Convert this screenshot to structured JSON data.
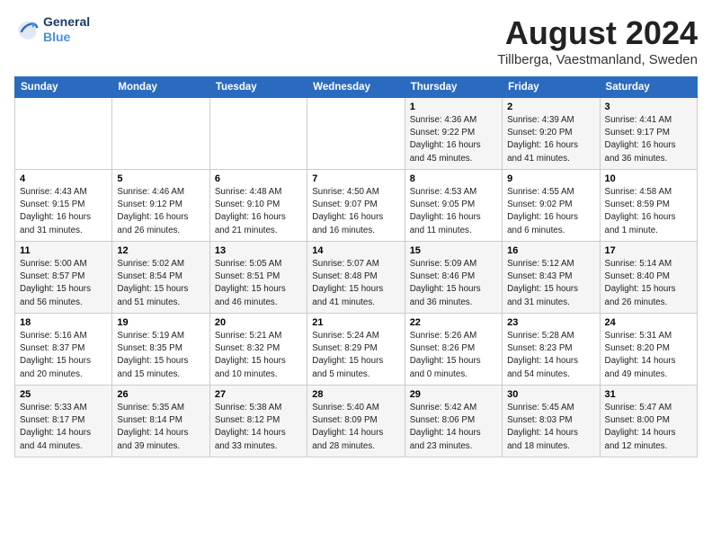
{
  "header": {
    "logo_line1": "General",
    "logo_line2": "Blue",
    "month": "August 2024",
    "location": "Tillberga, Vaestmanland, Sweden"
  },
  "weekdays": [
    "Sunday",
    "Monday",
    "Tuesday",
    "Wednesday",
    "Thursday",
    "Friday",
    "Saturday"
  ],
  "weeks": [
    [
      {
        "day": "",
        "info": ""
      },
      {
        "day": "",
        "info": ""
      },
      {
        "day": "",
        "info": ""
      },
      {
        "day": "",
        "info": ""
      },
      {
        "day": "1",
        "info": "Sunrise: 4:36 AM\nSunset: 9:22 PM\nDaylight: 16 hours\nand 45 minutes."
      },
      {
        "day": "2",
        "info": "Sunrise: 4:39 AM\nSunset: 9:20 PM\nDaylight: 16 hours\nand 41 minutes."
      },
      {
        "day": "3",
        "info": "Sunrise: 4:41 AM\nSunset: 9:17 PM\nDaylight: 16 hours\nand 36 minutes."
      }
    ],
    [
      {
        "day": "4",
        "info": "Sunrise: 4:43 AM\nSunset: 9:15 PM\nDaylight: 16 hours\nand 31 minutes."
      },
      {
        "day": "5",
        "info": "Sunrise: 4:46 AM\nSunset: 9:12 PM\nDaylight: 16 hours\nand 26 minutes."
      },
      {
        "day": "6",
        "info": "Sunrise: 4:48 AM\nSunset: 9:10 PM\nDaylight: 16 hours\nand 21 minutes."
      },
      {
        "day": "7",
        "info": "Sunrise: 4:50 AM\nSunset: 9:07 PM\nDaylight: 16 hours\nand 16 minutes."
      },
      {
        "day": "8",
        "info": "Sunrise: 4:53 AM\nSunset: 9:05 PM\nDaylight: 16 hours\nand 11 minutes."
      },
      {
        "day": "9",
        "info": "Sunrise: 4:55 AM\nSunset: 9:02 PM\nDaylight: 16 hours\nand 6 minutes."
      },
      {
        "day": "10",
        "info": "Sunrise: 4:58 AM\nSunset: 8:59 PM\nDaylight: 16 hours\nand 1 minute."
      }
    ],
    [
      {
        "day": "11",
        "info": "Sunrise: 5:00 AM\nSunset: 8:57 PM\nDaylight: 15 hours\nand 56 minutes."
      },
      {
        "day": "12",
        "info": "Sunrise: 5:02 AM\nSunset: 8:54 PM\nDaylight: 15 hours\nand 51 minutes."
      },
      {
        "day": "13",
        "info": "Sunrise: 5:05 AM\nSunset: 8:51 PM\nDaylight: 15 hours\nand 46 minutes."
      },
      {
        "day": "14",
        "info": "Sunrise: 5:07 AM\nSunset: 8:48 PM\nDaylight: 15 hours\nand 41 minutes."
      },
      {
        "day": "15",
        "info": "Sunrise: 5:09 AM\nSunset: 8:46 PM\nDaylight: 15 hours\nand 36 minutes."
      },
      {
        "day": "16",
        "info": "Sunrise: 5:12 AM\nSunset: 8:43 PM\nDaylight: 15 hours\nand 31 minutes."
      },
      {
        "day": "17",
        "info": "Sunrise: 5:14 AM\nSunset: 8:40 PM\nDaylight: 15 hours\nand 26 minutes."
      }
    ],
    [
      {
        "day": "18",
        "info": "Sunrise: 5:16 AM\nSunset: 8:37 PM\nDaylight: 15 hours\nand 20 minutes."
      },
      {
        "day": "19",
        "info": "Sunrise: 5:19 AM\nSunset: 8:35 PM\nDaylight: 15 hours\nand 15 minutes."
      },
      {
        "day": "20",
        "info": "Sunrise: 5:21 AM\nSunset: 8:32 PM\nDaylight: 15 hours\nand 10 minutes."
      },
      {
        "day": "21",
        "info": "Sunrise: 5:24 AM\nSunset: 8:29 PM\nDaylight: 15 hours\nand 5 minutes."
      },
      {
        "day": "22",
        "info": "Sunrise: 5:26 AM\nSunset: 8:26 PM\nDaylight: 15 hours\nand 0 minutes."
      },
      {
        "day": "23",
        "info": "Sunrise: 5:28 AM\nSunset: 8:23 PM\nDaylight: 14 hours\nand 54 minutes."
      },
      {
        "day": "24",
        "info": "Sunrise: 5:31 AM\nSunset: 8:20 PM\nDaylight: 14 hours\nand 49 minutes."
      }
    ],
    [
      {
        "day": "25",
        "info": "Sunrise: 5:33 AM\nSunset: 8:17 PM\nDaylight: 14 hours\nand 44 minutes."
      },
      {
        "day": "26",
        "info": "Sunrise: 5:35 AM\nSunset: 8:14 PM\nDaylight: 14 hours\nand 39 minutes."
      },
      {
        "day": "27",
        "info": "Sunrise: 5:38 AM\nSunset: 8:12 PM\nDaylight: 14 hours\nand 33 minutes."
      },
      {
        "day": "28",
        "info": "Sunrise: 5:40 AM\nSunset: 8:09 PM\nDaylight: 14 hours\nand 28 minutes."
      },
      {
        "day": "29",
        "info": "Sunrise: 5:42 AM\nSunset: 8:06 PM\nDaylight: 14 hours\nand 23 minutes."
      },
      {
        "day": "30",
        "info": "Sunrise: 5:45 AM\nSunset: 8:03 PM\nDaylight: 14 hours\nand 18 minutes."
      },
      {
        "day": "31",
        "info": "Sunrise: 5:47 AM\nSunset: 8:00 PM\nDaylight: 14 hours\nand 12 minutes."
      }
    ]
  ]
}
